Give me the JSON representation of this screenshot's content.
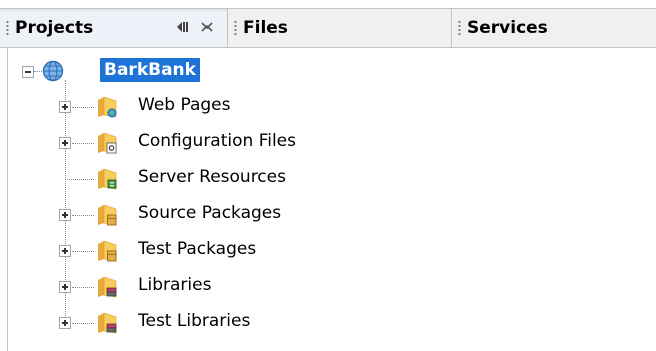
{
  "tabs": [
    {
      "label": "Projects",
      "active": true
    },
    {
      "label": "Files",
      "active": false
    },
    {
      "label": "Services",
      "active": false
    }
  ],
  "tab_icons": [
    "minimize-icon",
    "close-icon"
  ],
  "tree": {
    "root": {
      "label": "BarkBank",
      "icon": "globe-icon",
      "expanded": true,
      "selected": true
    },
    "children": [
      {
        "label": "Web Pages",
        "icon": "web-pages-folder-icon",
        "expandable": true
      },
      {
        "label": "Configuration Files",
        "icon": "configuration-folder-icon",
        "expandable": true
      },
      {
        "label": "Server Resources",
        "icon": "server-resources-folder-icon",
        "expandable": false
      },
      {
        "label": "Source Packages",
        "icon": "source-packages-folder-icon",
        "expandable": true
      },
      {
        "label": "Test Packages",
        "icon": "test-packages-folder-icon",
        "expandable": true
      },
      {
        "label": "Libraries",
        "icon": "libraries-folder-icon",
        "expandable": true
      },
      {
        "label": "Test Libraries",
        "icon": "test-libraries-folder-icon",
        "expandable": true
      }
    ]
  },
  "colors": {
    "selection": "#1e73d6",
    "folder": "#f3c04a",
    "tab_bar": "#f0f0f0"
  }
}
